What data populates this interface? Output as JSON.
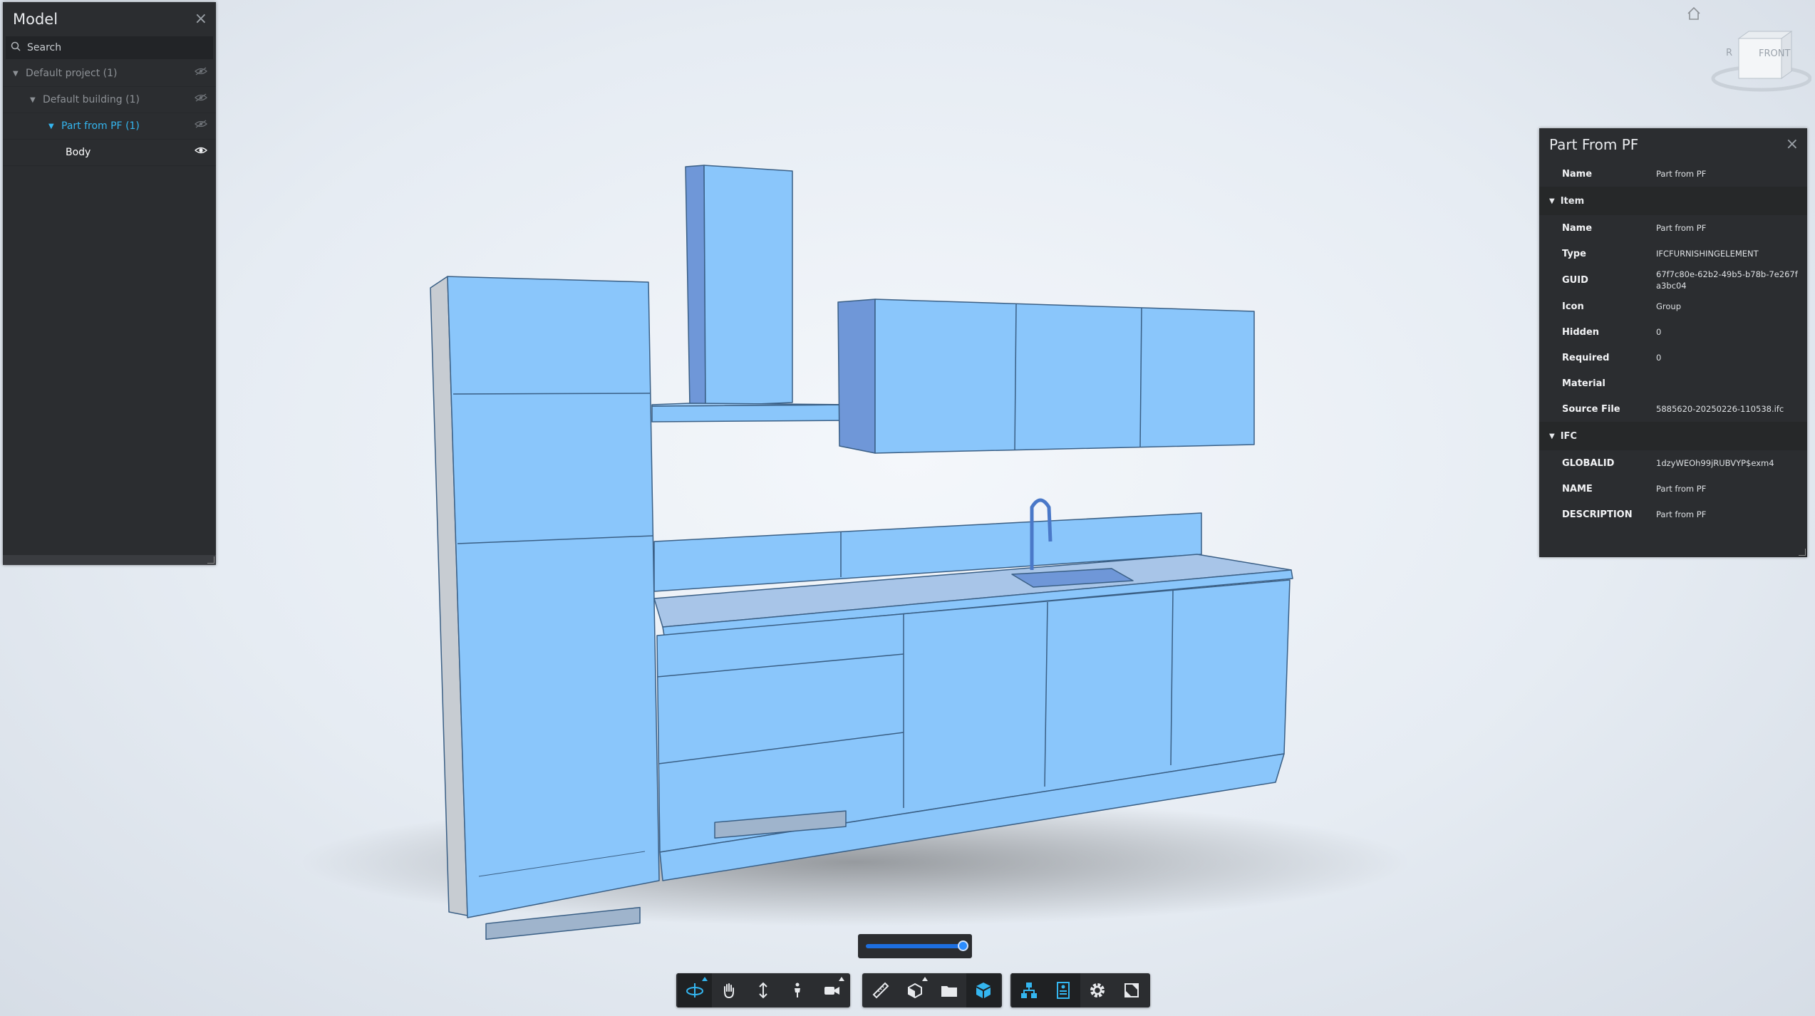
{
  "model_panel": {
    "title": "Model",
    "search_placeholder": "Search",
    "tree": [
      {
        "label": "Default project (1)"
      },
      {
        "label": "Default building (1)"
      },
      {
        "label": "Part from PF (1)"
      },
      {
        "label": "Body"
      }
    ]
  },
  "props_panel": {
    "title": "Part From PF",
    "top_row": {
      "key": "Name",
      "value": "Part from PF"
    },
    "groups": [
      {
        "name": "Item",
        "rows": [
          {
            "key": "Name",
            "value": "Part from PF"
          },
          {
            "key": "Type",
            "value": "IFCFURNISHINGELEMENT"
          },
          {
            "key": "GUID",
            "value": "67f7c80e-62b2-49b5-b78b-7e267fa3bc04"
          },
          {
            "key": "Icon",
            "value": "Group"
          },
          {
            "key": "Hidden",
            "value": "0"
          },
          {
            "key": "Required",
            "value": "0"
          },
          {
            "key": "Material",
            "value": ""
          },
          {
            "key": "Source File",
            "value": "5885620-20250226-110538.ifc"
          }
        ]
      },
      {
        "name": "IFC",
        "rows": [
          {
            "key": "GLOBALID",
            "value": "1dzyWEOh99jRUBVYP$exm4"
          },
          {
            "key": "NAME",
            "value": "Part from PF"
          },
          {
            "key": "DESCRIPTION",
            "value": "Part from PF"
          }
        ]
      }
    ]
  },
  "view_cube": {
    "face_label": "FRONT"
  },
  "slider": {
    "value_percent": 100
  },
  "toolbar": {
    "group1": [
      "orbit-icon",
      "pan-icon",
      "dolly-icon",
      "first-person-icon",
      "camera-icon"
    ],
    "group2": [
      "measure-icon",
      "section-icon",
      "explode-icon",
      "model-browser-icon"
    ],
    "group3": [
      "structure-icon",
      "properties-icon",
      "settings-icon",
      "fullscreen-icon"
    ]
  },
  "colors": {
    "accent": "#34b6f0",
    "panel_bg": "#2b2d30",
    "model_blue": "#8ac6fb"
  }
}
